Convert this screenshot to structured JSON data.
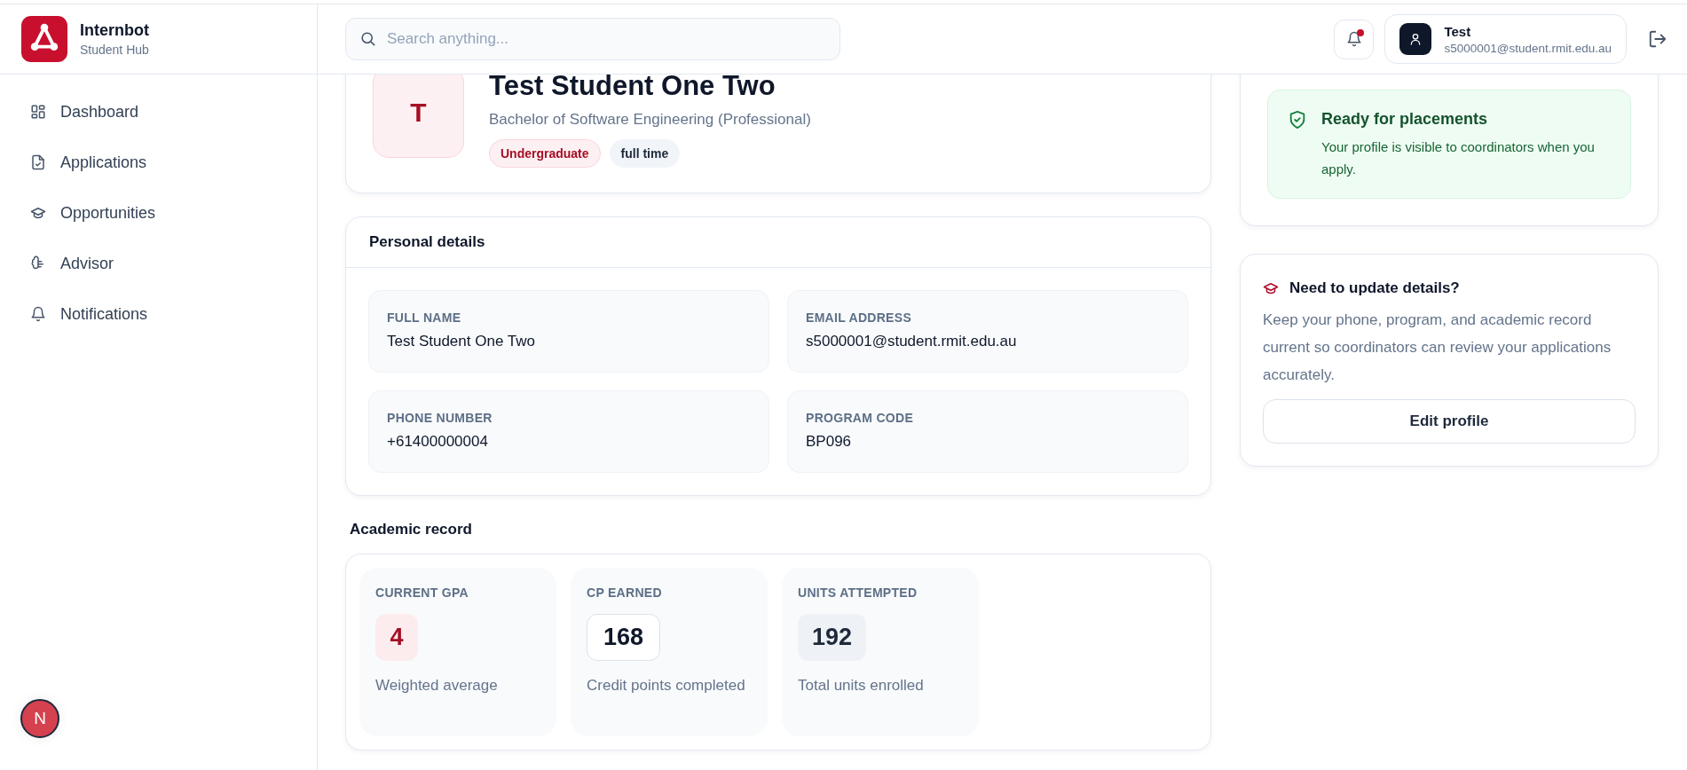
{
  "brand": {
    "name": "Internbot",
    "subtitle": "Student Hub"
  },
  "nav": [
    {
      "label": "Dashboard",
      "selected": false
    },
    {
      "label": "Applications",
      "selected": false
    },
    {
      "label": "Opportunities",
      "selected": false
    },
    {
      "label": "Advisor",
      "selected": false
    },
    {
      "label": "Notifications",
      "selected": false
    }
  ],
  "search": {
    "placeholder": "Search anything..."
  },
  "notifications": {
    "unread": true
  },
  "user": {
    "name": "Test",
    "email": "s5000001@student.rmit.edu.au"
  },
  "profile": {
    "initial": "T",
    "name": "Test Student One Two",
    "program": "Bachelor of Software Engineering (Professional)",
    "tags": [
      {
        "label": "Undergraduate",
        "kind": "primary"
      },
      {
        "label": "full time",
        "kind": "neutral"
      }
    ]
  },
  "personal_details": {
    "title": "Personal details",
    "fields": [
      {
        "label": "FULL NAME",
        "value": "Test Student One Two"
      },
      {
        "label": "EMAIL ADDRESS",
        "value": "s5000001@student.rmit.edu.au"
      },
      {
        "label": "PHONE NUMBER",
        "value": "+61400000004"
      },
      {
        "label": "PROGRAM CODE",
        "value": "BP096"
      }
    ]
  },
  "academic_record": {
    "title": "Academic record",
    "stats": [
      {
        "label": "CURRENT GPA",
        "value": "4",
        "caption": "Weighted average",
        "kind": "accent"
      },
      {
        "label": "CP EARNED",
        "value": "168",
        "caption": "Credit points completed",
        "kind": "outlined"
      },
      {
        "label": "UNITS ATTEMPTED",
        "value": "192",
        "caption": "Total units enrolled",
        "kind": "muted"
      }
    ]
  },
  "status": {
    "title": "Ready for placements",
    "text": "Your profile is visible to coordinators when you apply."
  },
  "update": {
    "title": "Need to update details?",
    "text": "Keep your phone, program, and academic record current so coordinators can review your applications accurately.",
    "button": "Edit profile"
  },
  "dev_badge": {
    "label": "N"
  }
}
